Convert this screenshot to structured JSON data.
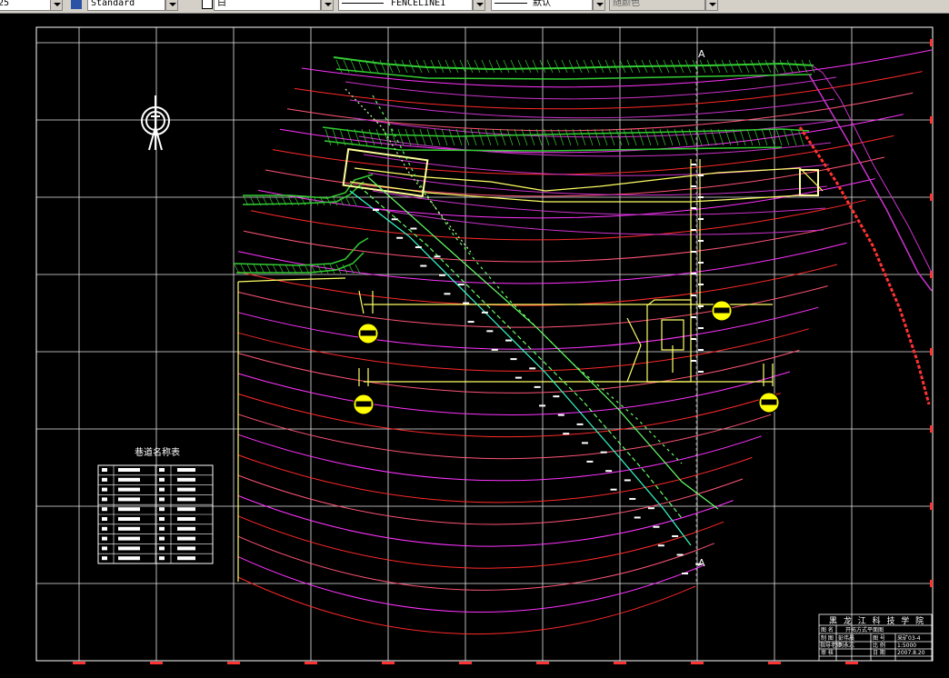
{
  "toolbar": {
    "layer_value": "25",
    "text_style": "Standard",
    "color_value": "白",
    "linetype_value": "FENCELINE1",
    "lineweight_value": "默认",
    "plotstyle_value": "随颜色"
  },
  "drawing": {
    "section_marker_top": "A",
    "section_marker_bottom": "A",
    "roadway_table": {
      "title": "巷道名称表"
    },
    "title_block": {
      "school": "黑 龙 江 科 技 学 院",
      "drawing_name_label": "图 名",
      "drawing_name": "开拓方式平面图",
      "drafter_label": "制 图",
      "drafter": "彭伟晨",
      "drawing_no_label": "图 号",
      "drawing_no": "采矿03-4",
      "advisor_label": "指导老师",
      "advisor": "刘永志",
      "scale_label": "比 例",
      "scale": "1:5000",
      "reviewer_label": "审 核",
      "date_label": "日 期",
      "date": "2007.8.20"
    },
    "colors": {
      "background": "#000000",
      "frame": "#ffffff",
      "contour_red": "#ff2a2a",
      "contour_magenta": "#ff33ff",
      "hatch_green": "#33cc33",
      "yellow": "#ffff00",
      "lime": "#99ff66",
      "cyan": "#33ffff"
    }
  }
}
